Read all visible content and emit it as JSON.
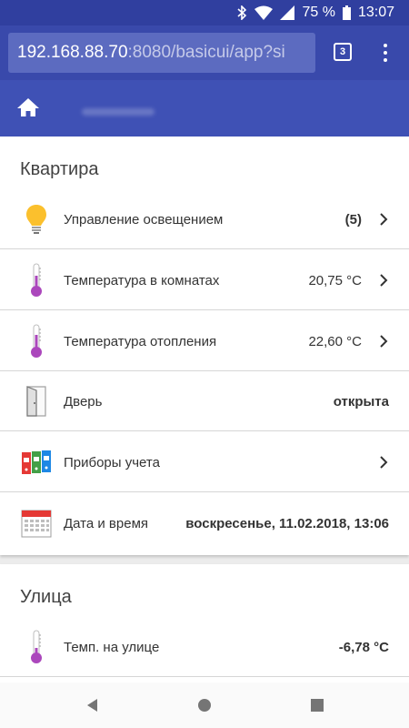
{
  "status": {
    "battery": "75 %",
    "time": "13:07"
  },
  "browser": {
    "url_host": "192.168.88.70",
    "url_rest": ":8080/basicui/app?si",
    "tab_count": "3"
  },
  "app": {
    "header_title": ""
  },
  "sections": [
    {
      "title": "Квартира",
      "items": [
        {
          "label": "Управление освещением",
          "value": "(5)",
          "has_arrow": true,
          "icon": "light-bulb-icon"
        },
        {
          "label": "Температура в комнатах",
          "value": "20,75 °C",
          "has_arrow": true,
          "icon": "thermometer-icon"
        },
        {
          "label": "Температура отопления",
          "value": "22,60 °C",
          "has_arrow": true,
          "icon": "thermometer-icon"
        },
        {
          "label": "Дверь",
          "value": "открыта",
          "has_arrow": false,
          "icon": "door-icon"
        },
        {
          "label": "Приборы учета",
          "value": "",
          "has_arrow": true,
          "icon": "binders-icon"
        },
        {
          "label": "Дата и время",
          "value": "воскресенье, 11.02.2018, 13:06",
          "has_arrow": false,
          "icon": "calendar-icon"
        }
      ]
    },
    {
      "title": "Улица",
      "items": [
        {
          "label": "Темп. на улице",
          "value": "-6,78 °C",
          "has_arrow": false,
          "icon": "thermometer-icon"
        }
      ]
    }
  ],
  "colors": {
    "status_bar": "#303f9f",
    "browser_bar": "#3949ab",
    "app_header": "#3f51b5",
    "thermometer": "#ab47bc",
    "bulb": "#fbc02d"
  }
}
